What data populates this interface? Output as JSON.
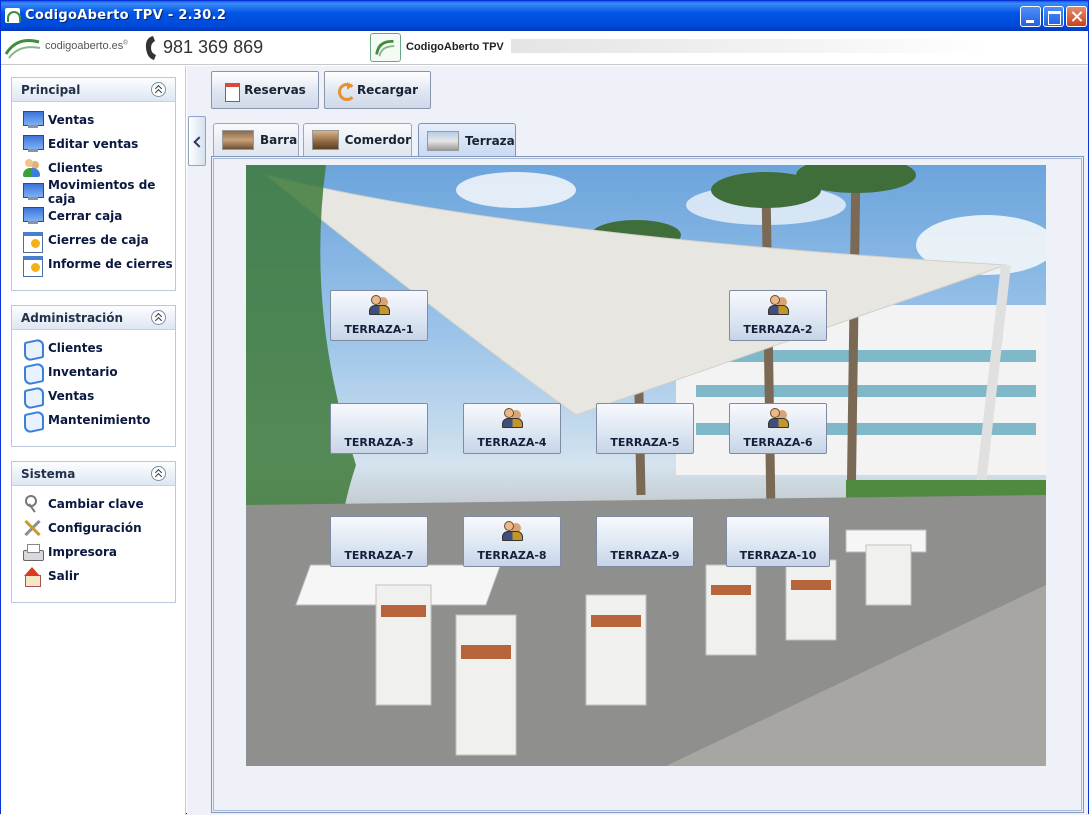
{
  "window": {
    "title": "CodigoAberto TPV - 2.30.2"
  },
  "header": {
    "brand_text": "codigoaberto.es",
    "brand_mark": "®",
    "phone": "981 369 869",
    "app_name": "CodigoAberto TPV"
  },
  "sidebar": {
    "panels": [
      {
        "title": "Principal",
        "items": [
          {
            "label": "Ventas",
            "icon": "monitor-icon"
          },
          {
            "label": "Editar ventas",
            "icon": "monitor-icon"
          },
          {
            "label": "Clientes",
            "icon": "users-icon"
          },
          {
            "label": "Movimientos de caja",
            "icon": "monitor-icon"
          },
          {
            "label": "Cerrar caja",
            "icon": "monitor-icon"
          },
          {
            "label": "Cierres de caja",
            "icon": "calendar-icon"
          },
          {
            "label": "Informe de cierres",
            "icon": "calendar-icon"
          }
        ]
      },
      {
        "title": "Administración",
        "items": [
          {
            "label": "Clientes",
            "icon": "book-icon"
          },
          {
            "label": "Inventario",
            "icon": "book-icon"
          },
          {
            "label": "Ventas",
            "icon": "book-icon"
          },
          {
            "label": "Mantenimiento",
            "icon": "book-icon"
          }
        ]
      },
      {
        "title": "Sistema",
        "items": [
          {
            "label": "Cambiar clave",
            "icon": "key-icon"
          },
          {
            "label": "Configuración",
            "icon": "tools-icon"
          },
          {
            "label": "Impresora",
            "icon": "printer-icon"
          },
          {
            "label": "Salir",
            "icon": "home-icon"
          }
        ]
      }
    ]
  },
  "toolbar": {
    "reservas_label": "Reservas",
    "recargar_label": "Recargar"
  },
  "tabs": [
    {
      "label": "Barra",
      "active": false
    },
    {
      "label": "Comerdor",
      "active": false
    },
    {
      "label": "Terraza",
      "active": true
    }
  ],
  "tables": [
    {
      "name": "TERRAZA-1",
      "occupied": true
    },
    {
      "name": "TERRAZA-2",
      "occupied": true
    },
    {
      "name": "TERRAZA-3",
      "occupied": false
    },
    {
      "name": "TERRAZA-4",
      "occupied": true
    },
    {
      "name": "TERRAZA-5",
      "occupied": false
    },
    {
      "name": "TERRAZA-6",
      "occupied": true
    },
    {
      "name": "TERRAZA-7",
      "occupied": false
    },
    {
      "name": "TERRAZA-8",
      "occupied": true
    },
    {
      "name": "TERRAZA-9",
      "occupied": false
    },
    {
      "name": "TERRAZA-10",
      "occupied": false
    }
  ]
}
